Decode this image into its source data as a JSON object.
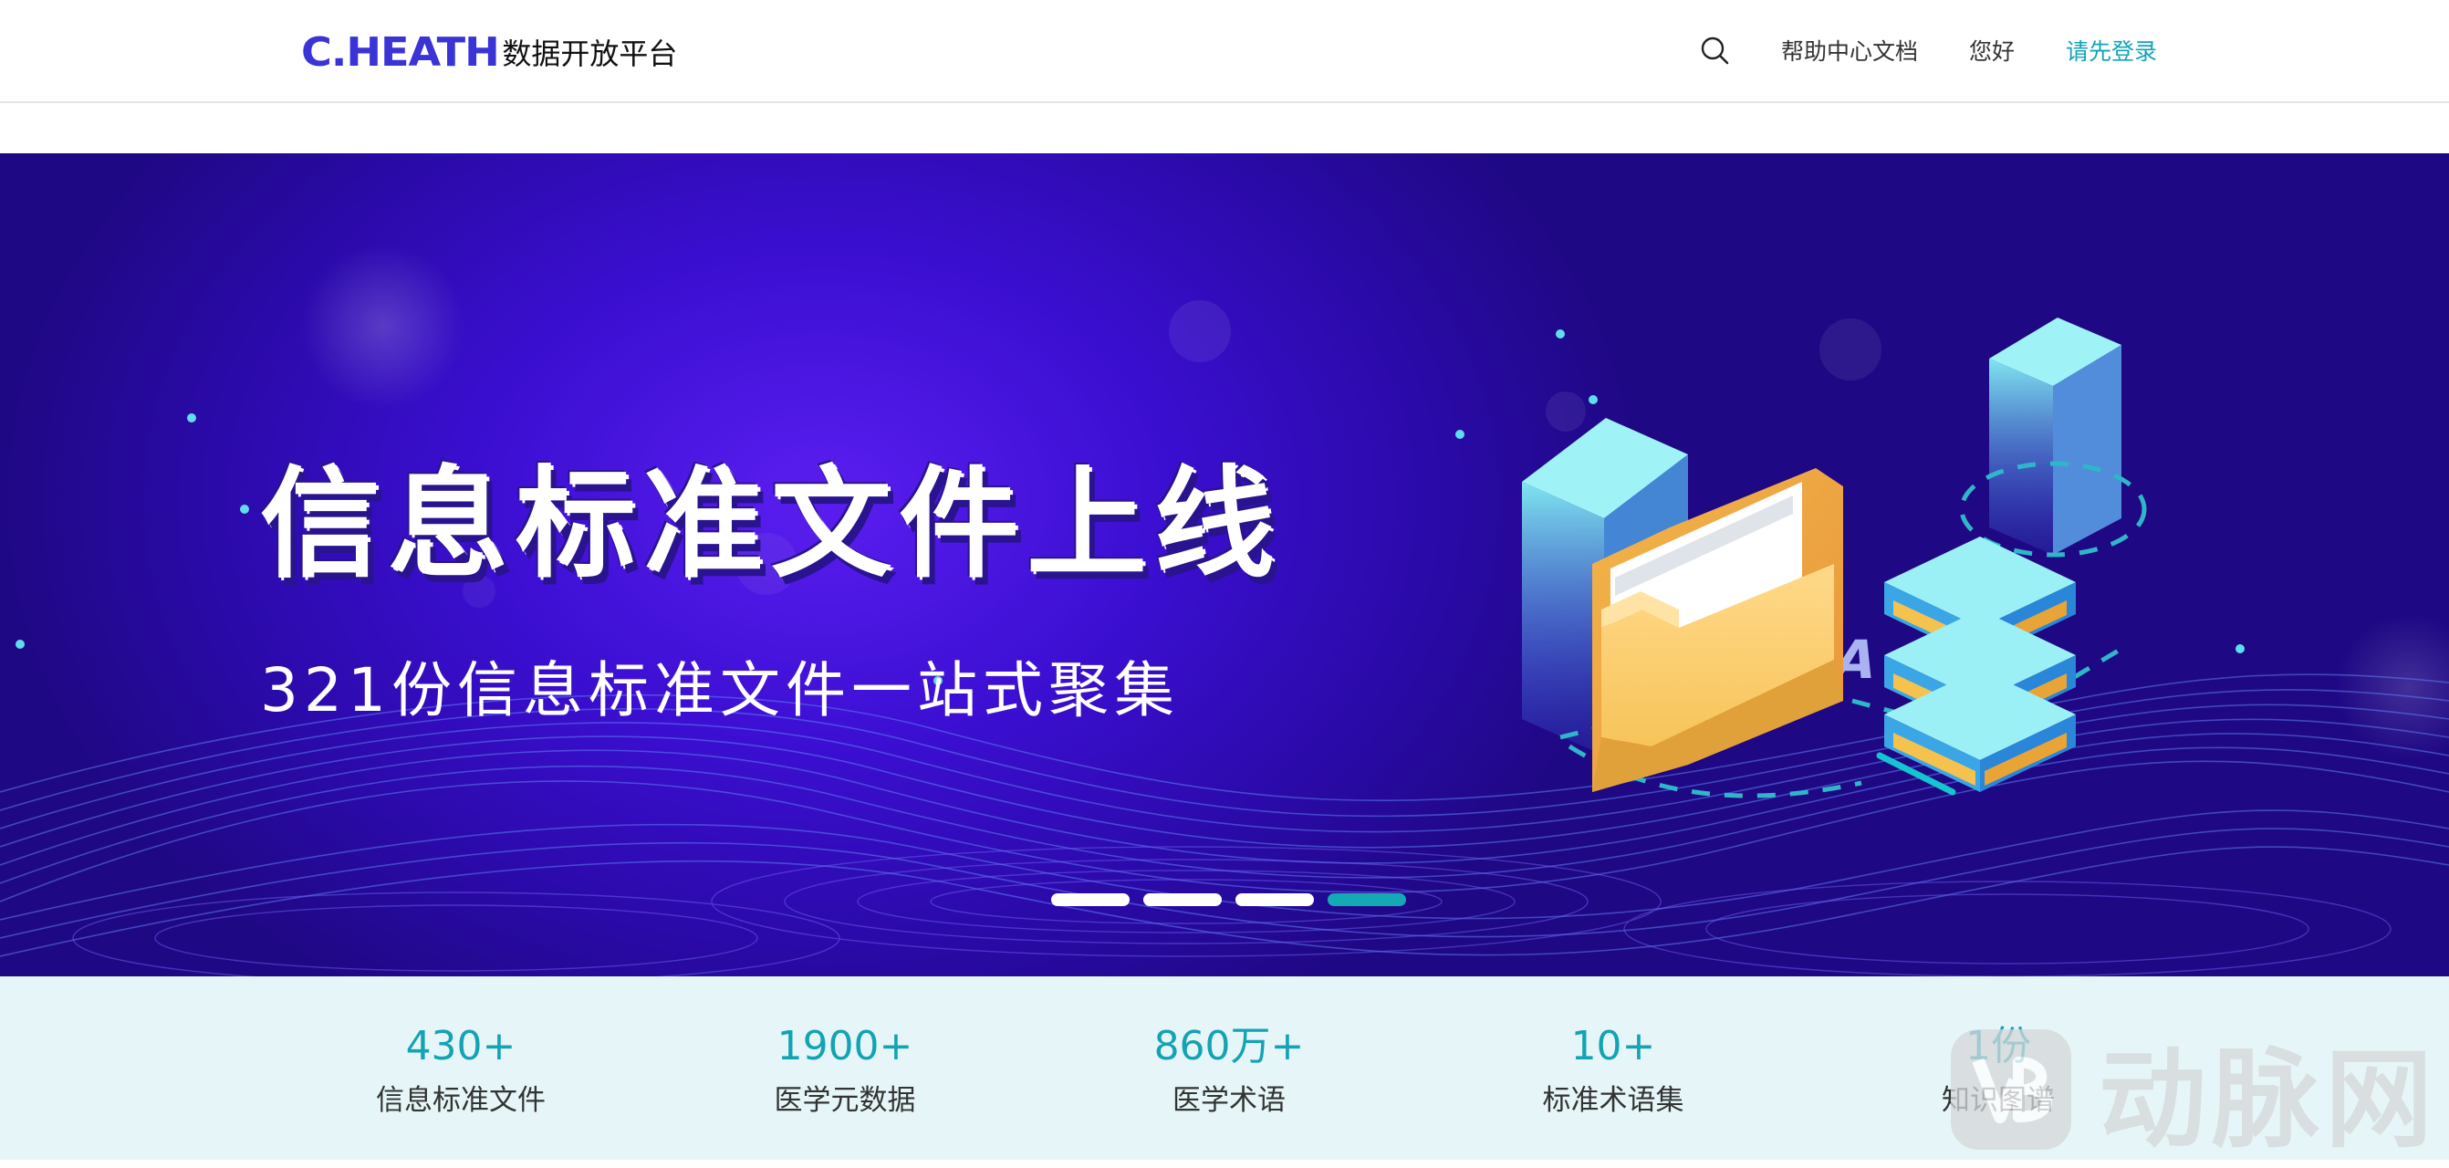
{
  "header": {
    "logo_mark": "C.HEATH",
    "logo_text": "数据开放平台",
    "nav": {
      "search_icon": "search-icon",
      "help_docs": "帮助中心文档",
      "greeting": "您好",
      "login": "请先登录"
    }
  },
  "banner": {
    "title": "信息标准文件上线",
    "subtitle": "321份信息标准文件一站式聚集",
    "carousel": {
      "slide_count": 4,
      "active_index": 3
    },
    "colors": {
      "background": "#3c0fd3",
      "accent": "#14a9b5"
    }
  },
  "stats": [
    {
      "value": "430+",
      "label": "信息标准文件"
    },
    {
      "value": "1900+",
      "label": "医学元数据"
    },
    {
      "value": "860万+",
      "label": "医学术语"
    },
    {
      "value": "10+",
      "label": "标准术语集"
    },
    {
      "value": "1份",
      "label": "知识图谱"
    }
  ],
  "watermark": {
    "text": "动脉网",
    "logo_icon": "vb-logo-icon"
  },
  "colors": {
    "brand": "#3a33d6",
    "link_accent": "#12a4b8",
    "stats_background": "#e6f6f8",
    "stat_value": "#13a3b4"
  }
}
